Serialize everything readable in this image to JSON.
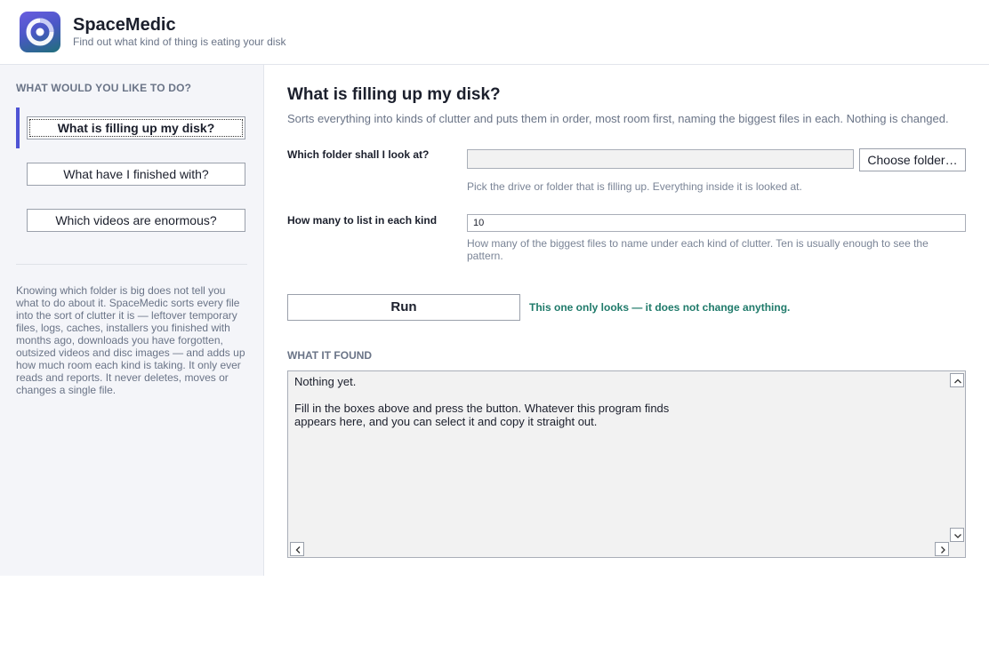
{
  "app": {
    "title": "SpaceMedic",
    "subtitle": "Find out what kind of thing is eating your disk"
  },
  "sidebar": {
    "heading": "WHAT WOULD YOU LIKE TO DO?",
    "items": [
      {
        "label": "What is filling up my disk?",
        "active": true
      },
      {
        "label": "What have I finished with?",
        "active": false
      },
      {
        "label": "Which videos are enormous?",
        "active": false
      }
    ],
    "description": "Knowing which folder is big does not tell you what to do about it. SpaceMedic sorts every file into the sort of clutter it is — leftover temporary files, logs, caches, installers you finished with months ago, downloads you have forgotten, outsized videos and disc images — and adds up how much room each kind is taking. It only ever reads and reports. It never deletes, moves or changes a single file."
  },
  "main": {
    "title": "What is filling up my disk?",
    "description": "Sorts everything into kinds of clutter and puts them in order, most room first, naming the biggest files in each. Nothing is changed.",
    "folder": {
      "label": "Which folder shall I look at?",
      "value": "",
      "button_label": "Choose folder…",
      "help": "Pick the drive or folder that is filling up. Everything inside it is looked at."
    },
    "count": {
      "label": "How many to list in each kind",
      "value": "10",
      "help": "How many of the biggest files to name under each kind of clutter. Ten is usually enough to see the pattern."
    },
    "run_label": "Run",
    "run_note": "This one only looks — it does not change anything.",
    "found_heading": "WHAT IT FOUND",
    "output": "Nothing yet.\n\nFill in the boxes above and press the button. Whatever this program finds\nappears here, and you can select it and copy it straight out."
  },
  "colors": {
    "accent": "#4e53d4",
    "note_green": "#1f7a6a",
    "muted_text": "#6a7487",
    "sidebar_bg": "#f4f5f9"
  },
  "icons": {
    "logo": "disk-ring-logo-icon",
    "scroll_up": "chevron-up-icon",
    "scroll_down": "chevron-down-icon",
    "scroll_left": "chevron-left-icon",
    "scroll_right": "chevron-right-icon"
  }
}
